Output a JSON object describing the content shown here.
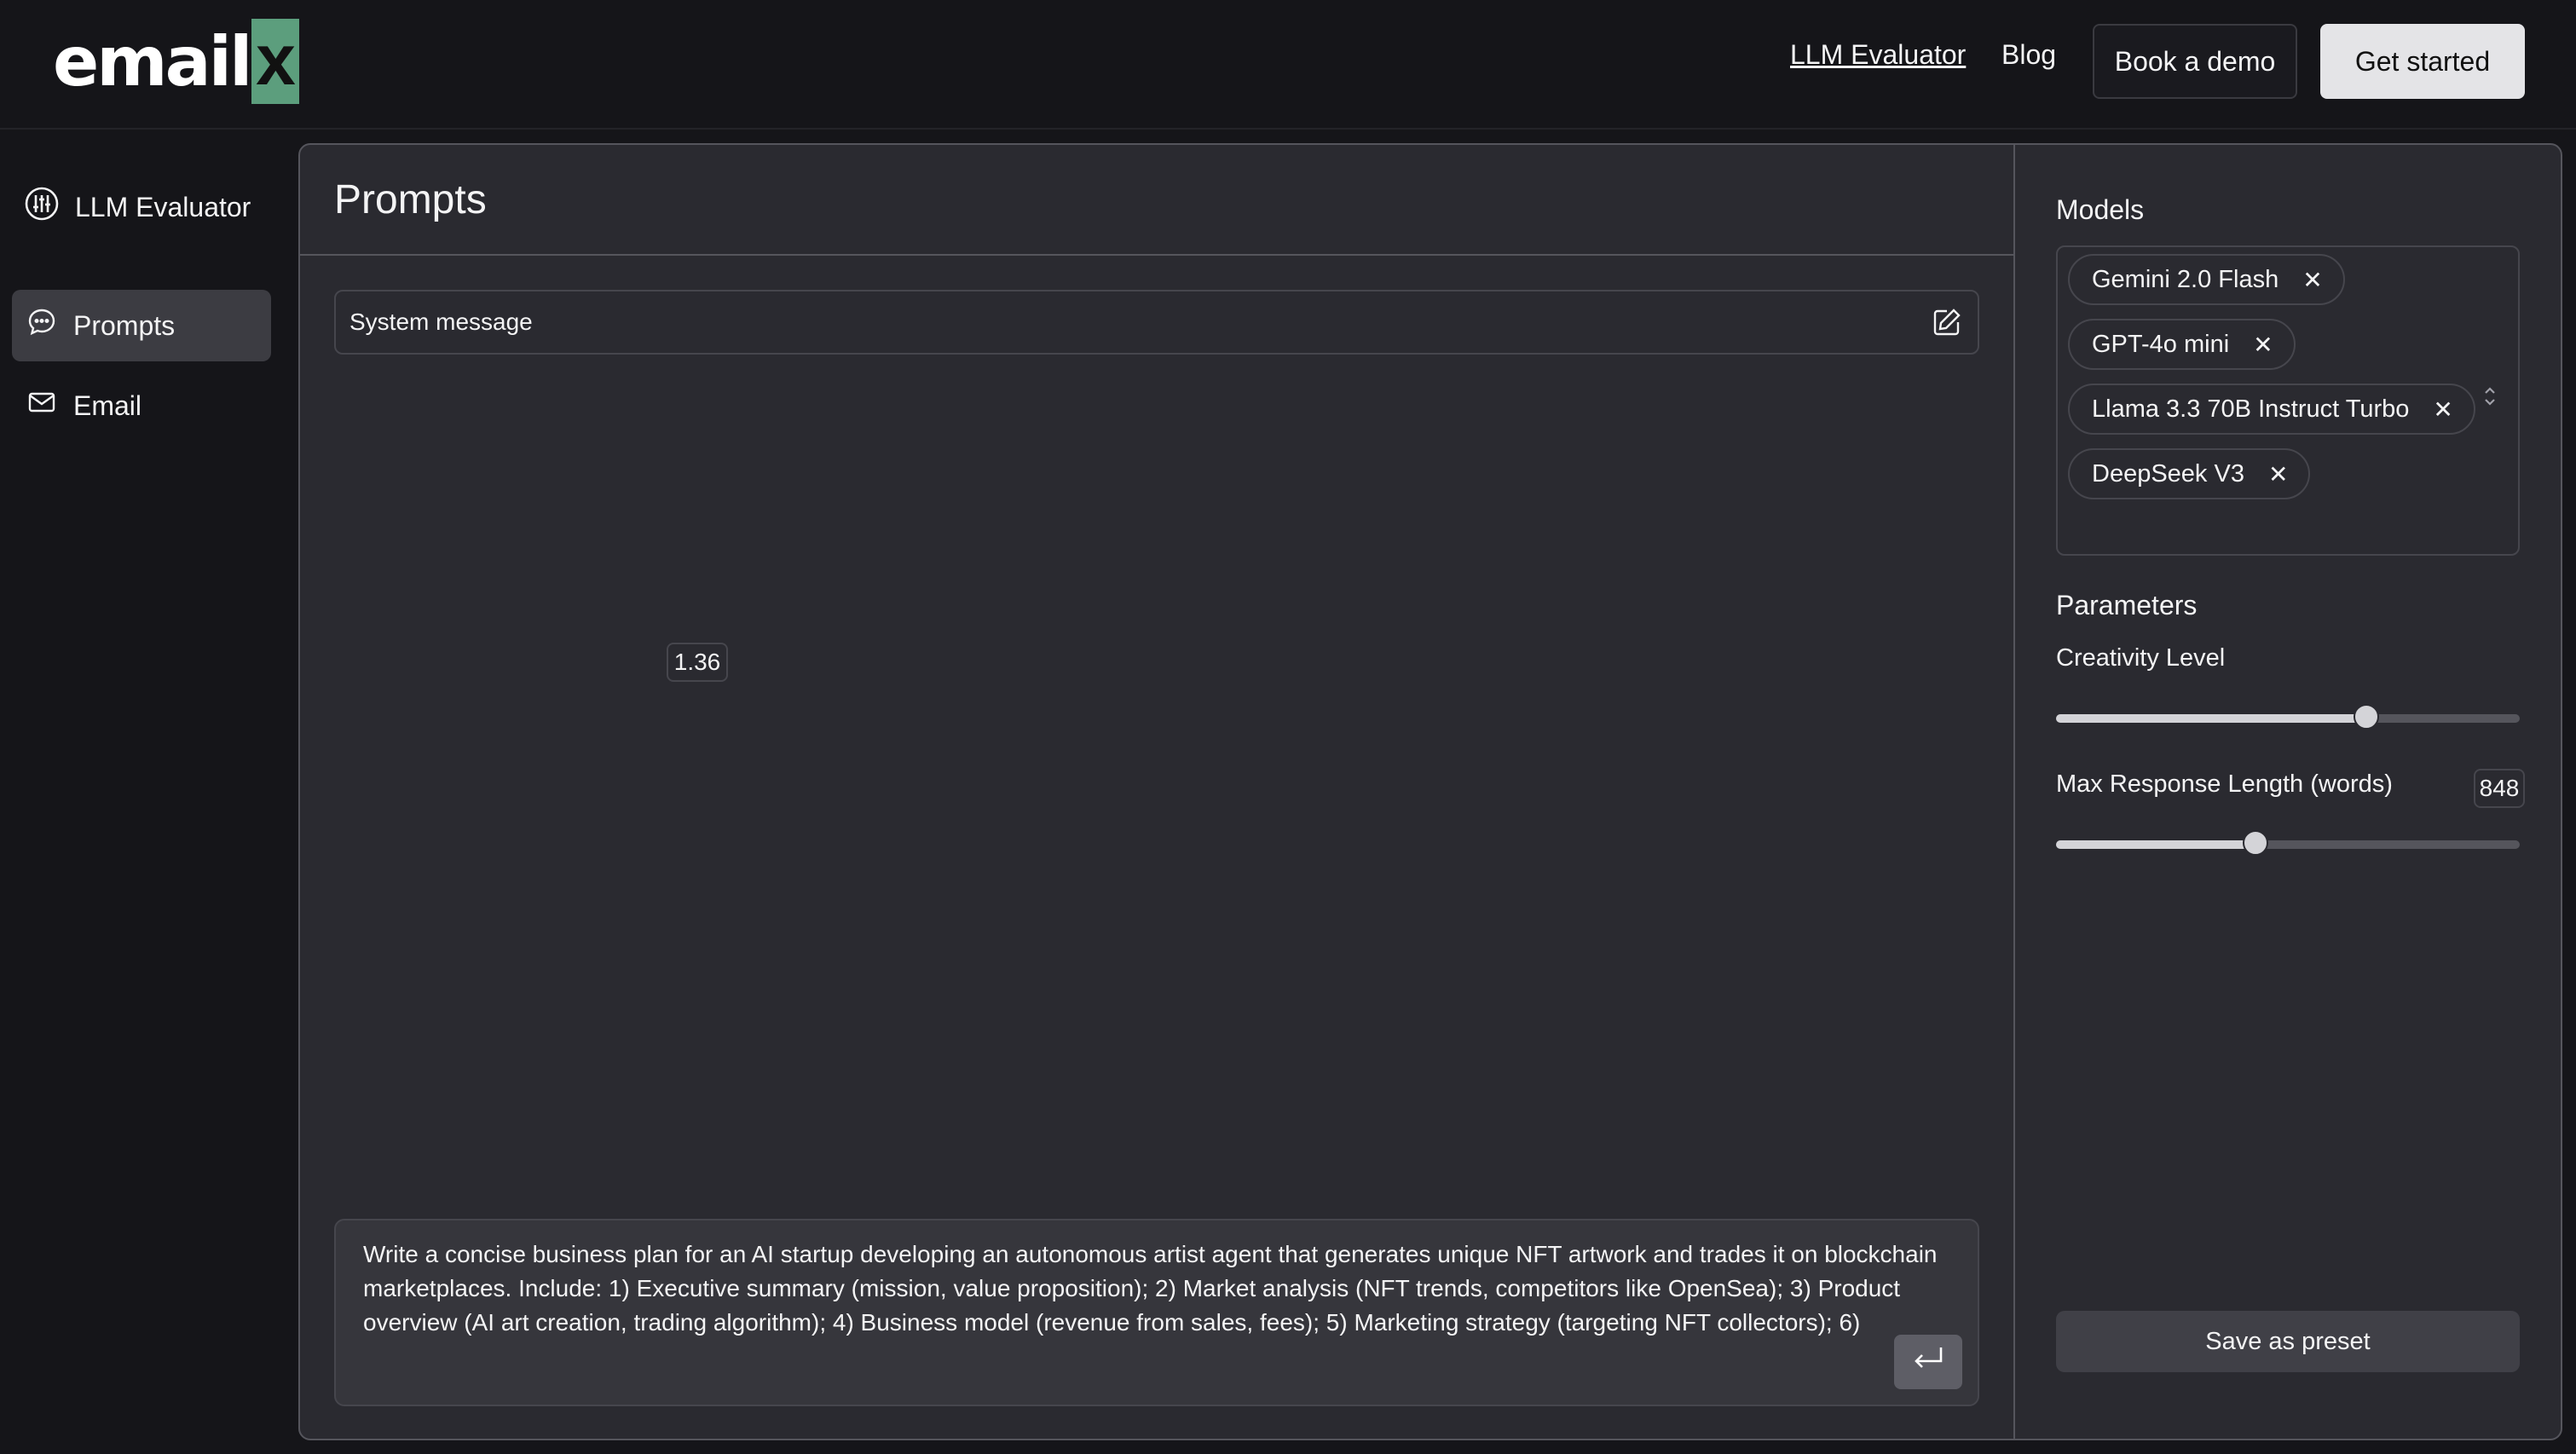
{
  "brand": {
    "logo_text": "email",
    "logo_accent": "x"
  },
  "nav": {
    "llm_evaluator": "LLM Evaluator",
    "blog": "Blog",
    "book_demo": "Book a demo",
    "get_started": "Get started"
  },
  "sidebar": {
    "title": "LLM Evaluator",
    "items": [
      {
        "label": "Prompts",
        "icon": "chat-bubble-icon",
        "active": true
      },
      {
        "label": "Email",
        "icon": "mail-icon",
        "active": false
      }
    ]
  },
  "prompts": {
    "title": "Prompts",
    "system_message": "System message",
    "user_prompt": "Write a concise business plan for an AI startup developing an autonomous artist agent that generates unique NFT artwork and trades it on blockchain marketplaces. Include: 1) Executive summary (mission, value proposition); 2) Market analysis (NFT trends, competitors like OpenSea); 3) Product overview (AI art creation, trading algorithm); 4) Business model (revenue from sales, fees); 5) Marketing strategy (targeting NFT collectors); 6)"
  },
  "models": {
    "title": "Models",
    "selected": [
      "Gemini 2.0 Flash",
      "GPT-4o mini",
      "Llama 3.3 70B Instruct Turbo",
      "DeepSeek V3"
    ]
  },
  "parameters": {
    "title": "Parameters",
    "creativity": {
      "label": "Creativity Level",
      "value": "1.36",
      "fraction": 0.67
    },
    "max_length": {
      "label": "Max Response Length (words)",
      "value": "848",
      "fraction": 0.43
    }
  },
  "actions": {
    "save_preset": "Save as preset"
  },
  "colors": {
    "background": "#151519",
    "panel": "#2a2a30",
    "brand_accent": "#5c9e7d",
    "primary_button": "#e4e4e7"
  }
}
